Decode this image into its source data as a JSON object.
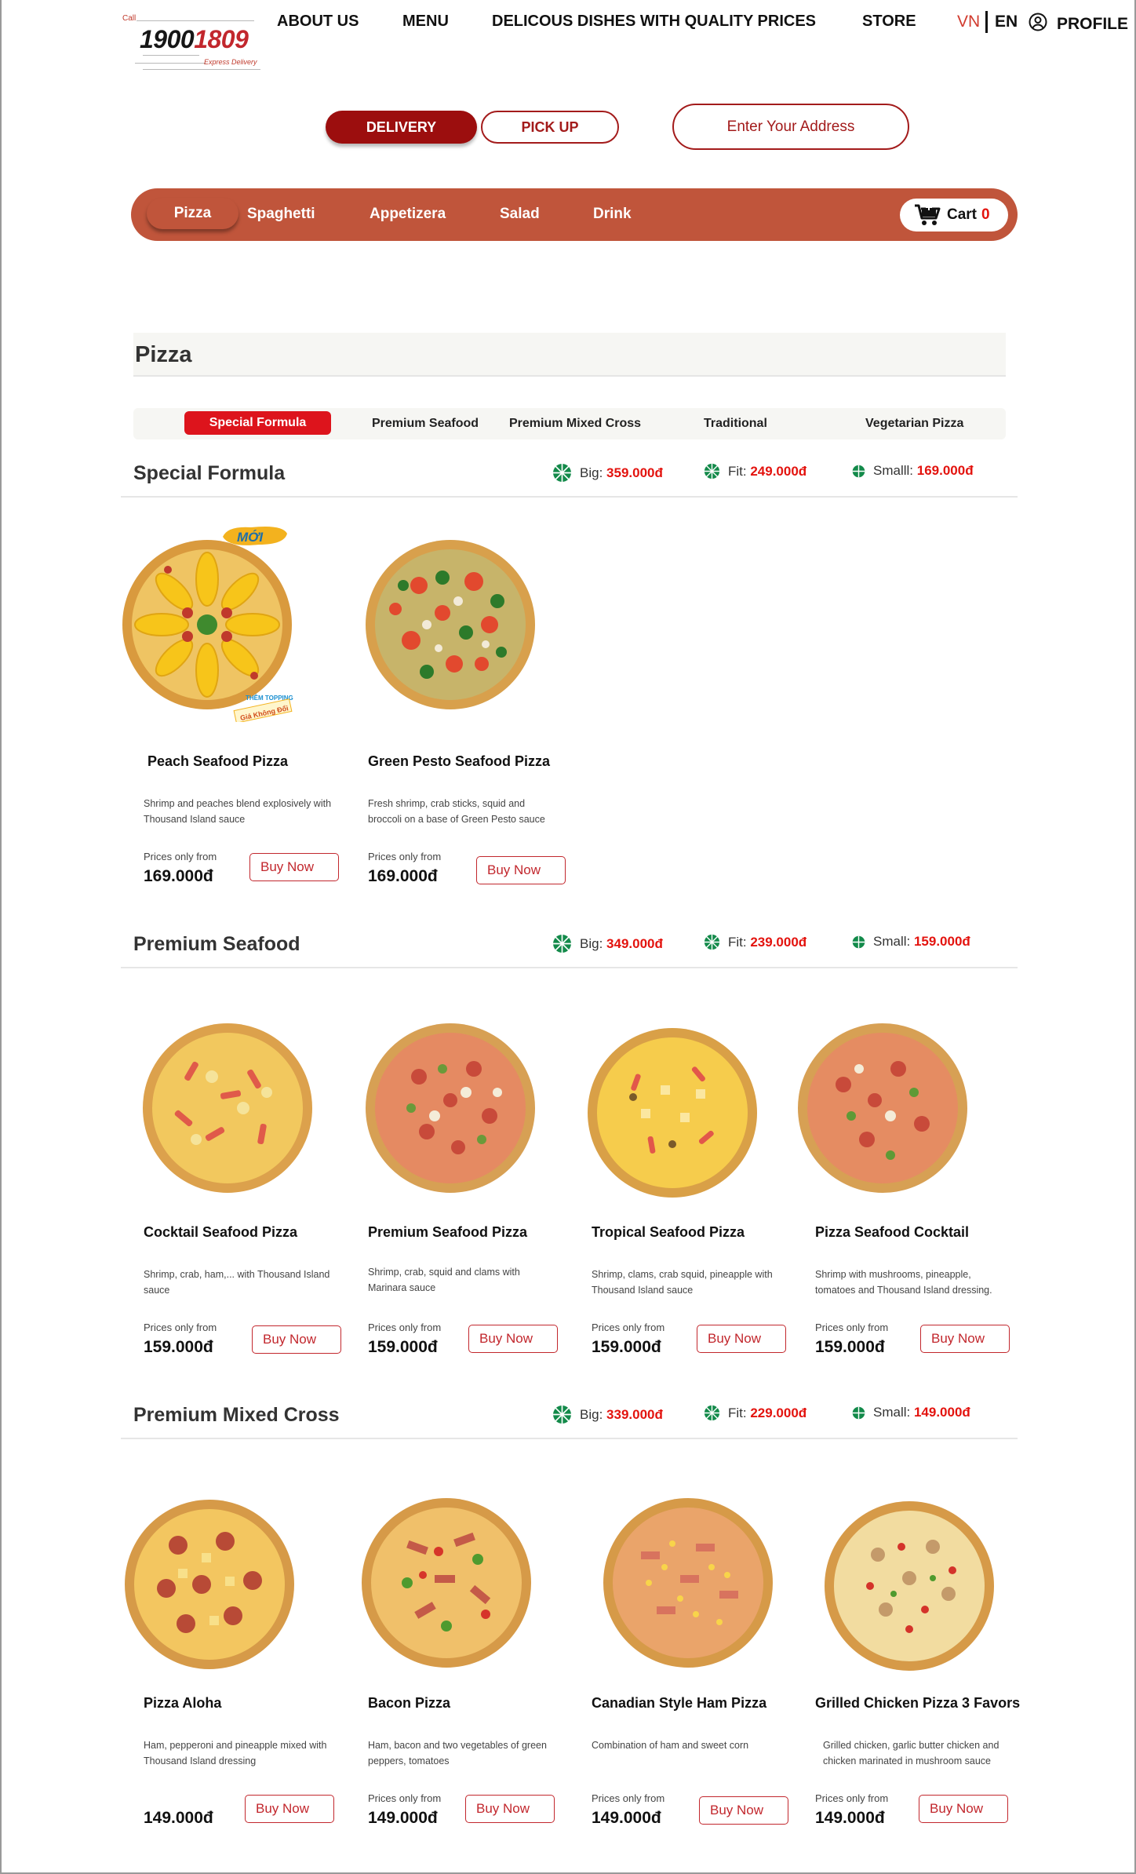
{
  "header": {
    "logo": {
      "call": "Call",
      "number_a": "1900",
      "number_b": "1809",
      "tagline": "Express Delivery"
    },
    "nav": [
      "ABOUT US",
      "MENU",
      "DELICOUS DISHES WITH QUALITY PRICES",
      "STORE"
    ],
    "lang_vn": "VN",
    "lang_en": "EN",
    "profile": "PROFILE"
  },
  "order_mode": {
    "delivery": "DELIVERY",
    "pickup": "PICK UP",
    "address_placeholder": "Enter Your Address"
  },
  "categories": {
    "items": [
      "Pizza",
      "Spaghetti",
      "Appetizera",
      "Salad",
      "Drink"
    ],
    "cart_label": "Cart",
    "cart_count": "0"
  },
  "section": {
    "title": "Pizza"
  },
  "subtabs": [
    "Special Formula",
    "Premium Seafood",
    "Premium Mixed Cross",
    "Traditional",
    "Vegetarian Pizza"
  ],
  "groups": [
    {
      "title": "Special Formula",
      "sizes": [
        {
          "label": "Big:",
          "price": "359.000đ"
        },
        {
          "label": "Fit:",
          "price": "249.000đ"
        },
        {
          "label": "Smalll:",
          "price": "169.000đ"
        }
      ],
      "products": [
        {
          "name": "Peach Seafood Pizza",
          "desc": "Shrimp and peaches blend explosively with Thousand Island sauce",
          "from": "Prices only from",
          "price": "169.000đ",
          "buy": "Buy Now"
        },
        {
          "name": "Green Pesto Seafood Pizza",
          "desc": "Fresh shrimp, crab sticks, squid and broccoli on a base of Green Pesto sauce",
          "from": "Prices only from",
          "price": "169.000đ",
          "buy": "Buy Now"
        }
      ]
    },
    {
      "title": "Premium Seafood",
      "sizes": [
        {
          "label": "Big:",
          "price": "349.000đ"
        },
        {
          "label": "Fit:",
          "price": "239.000đ"
        },
        {
          "label": "Small:",
          "price": "159.000đ"
        }
      ],
      "products": [
        {
          "name": "Cocktail Seafood Pizza",
          "desc": "Shrimp, crab, ham,... with Thousand Island sauce",
          "from": "Prices only from",
          "price": "159.000đ",
          "buy": "Buy Now"
        },
        {
          "name": "Premium Seafood Pizza",
          "desc": "Shrimp, crab, squid and clams with Marinara sauce",
          "from": "Prices only from",
          "price": "159.000đ",
          "buy": "Buy Now"
        },
        {
          "name": "Tropical Seafood Pizza",
          "desc": "Shrimp, clams, crab squid, pineapple with Thousand Island sauce",
          "from": "Prices only from",
          "price": "159.000đ",
          "buy": "Buy Now"
        },
        {
          "name": "Pizza Seafood Cocktail",
          "desc": "Shrimp with mushrooms, pineapple, tomatoes and Thousand Island dressing.",
          "from": "Prices only from",
          "price": "159.000đ",
          "buy": "Buy Now"
        }
      ]
    },
    {
      "title": "Premium Mixed Cross",
      "sizes": [
        {
          "label": "Big:",
          "price": "339.000đ"
        },
        {
          "label": "Fit:",
          "price": "229.000đ"
        },
        {
          "label": "Small:",
          "price": "149.000đ"
        }
      ],
      "products": [
        {
          "name": "Pizza Aloha",
          "desc": "Ham, pepperoni and pineapple mixed with Thousand Island dressing",
          "from": "",
          "price": "149.000đ",
          "buy": "Buy Now"
        },
        {
          "name": "Bacon Pizza",
          "desc": "Ham, bacon and two vegetables of green peppers, tomatoes",
          "from": "Prices only from",
          "price": "149.000đ",
          "buy": "Buy Now"
        },
        {
          "name": "Canadian Style Ham Pizza",
          "desc": "Combination of ham and sweet corn",
          "from": "Prices only from",
          "price": "149.000đ",
          "buy": "Buy Now"
        },
        {
          "name": "Grilled Chicken Pizza 3 Favors",
          "desc": "Grilled chicken, garlic butter chicken and chicken marinated in mushroom sauce",
          "from": "Prices only from",
          "price": "149.000đ",
          "buy": "Buy Now"
        }
      ]
    }
  ],
  "badges": {
    "new": "MỚI",
    "topping_1": "THÊM TOPPING",
    "topping_2": "Giá Không Đổi"
  },
  "colors": {
    "brand_red": "#c2272d",
    "dark_red": "#9c0e0e",
    "category_bar": "#c0553b",
    "price_red": "#e3130e"
  }
}
